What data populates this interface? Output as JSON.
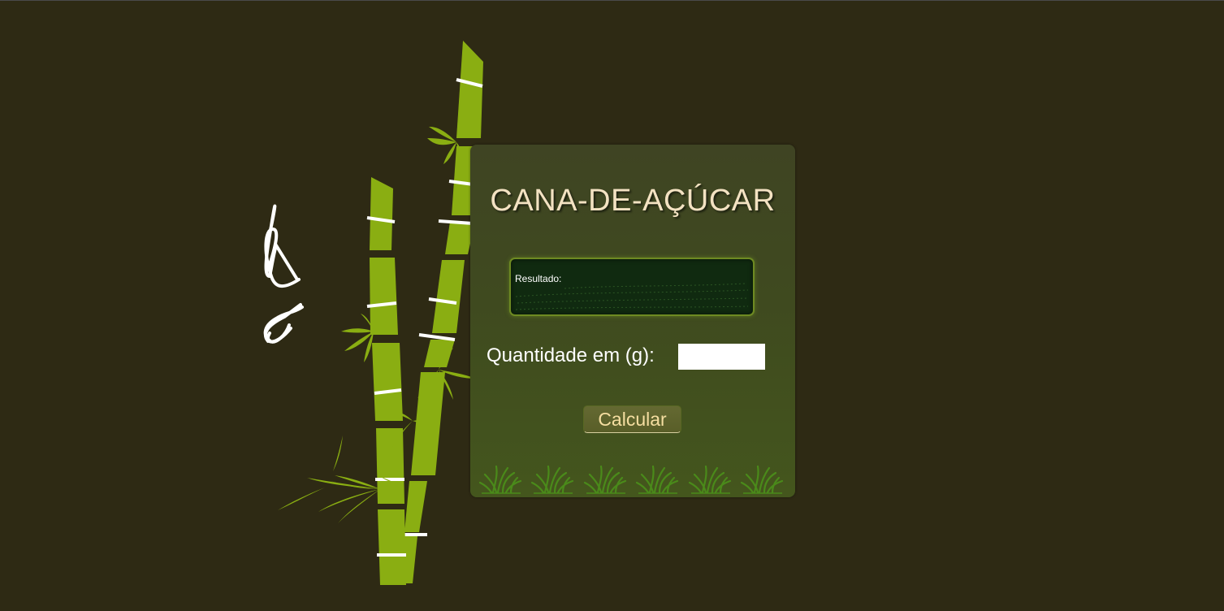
{
  "card": {
    "title": "CANA-DE-AÇÚCAR",
    "result": {
      "label": "Resultado:"
    },
    "quantity": {
      "label": "Quantidade em (g):",
      "value": ""
    },
    "calculate_button": "Calcular"
  },
  "colors": {
    "background": "#2e2a14",
    "cane_green": "#8aae12",
    "card_green": "#44561d",
    "title_color": "#f3e2c2",
    "button_text": "#f5dea1",
    "result_bg": "#102a10"
  },
  "icons": {
    "illustration": "sugarcane-illustration",
    "signature": "signature-icon",
    "grass": "grass-icon"
  }
}
